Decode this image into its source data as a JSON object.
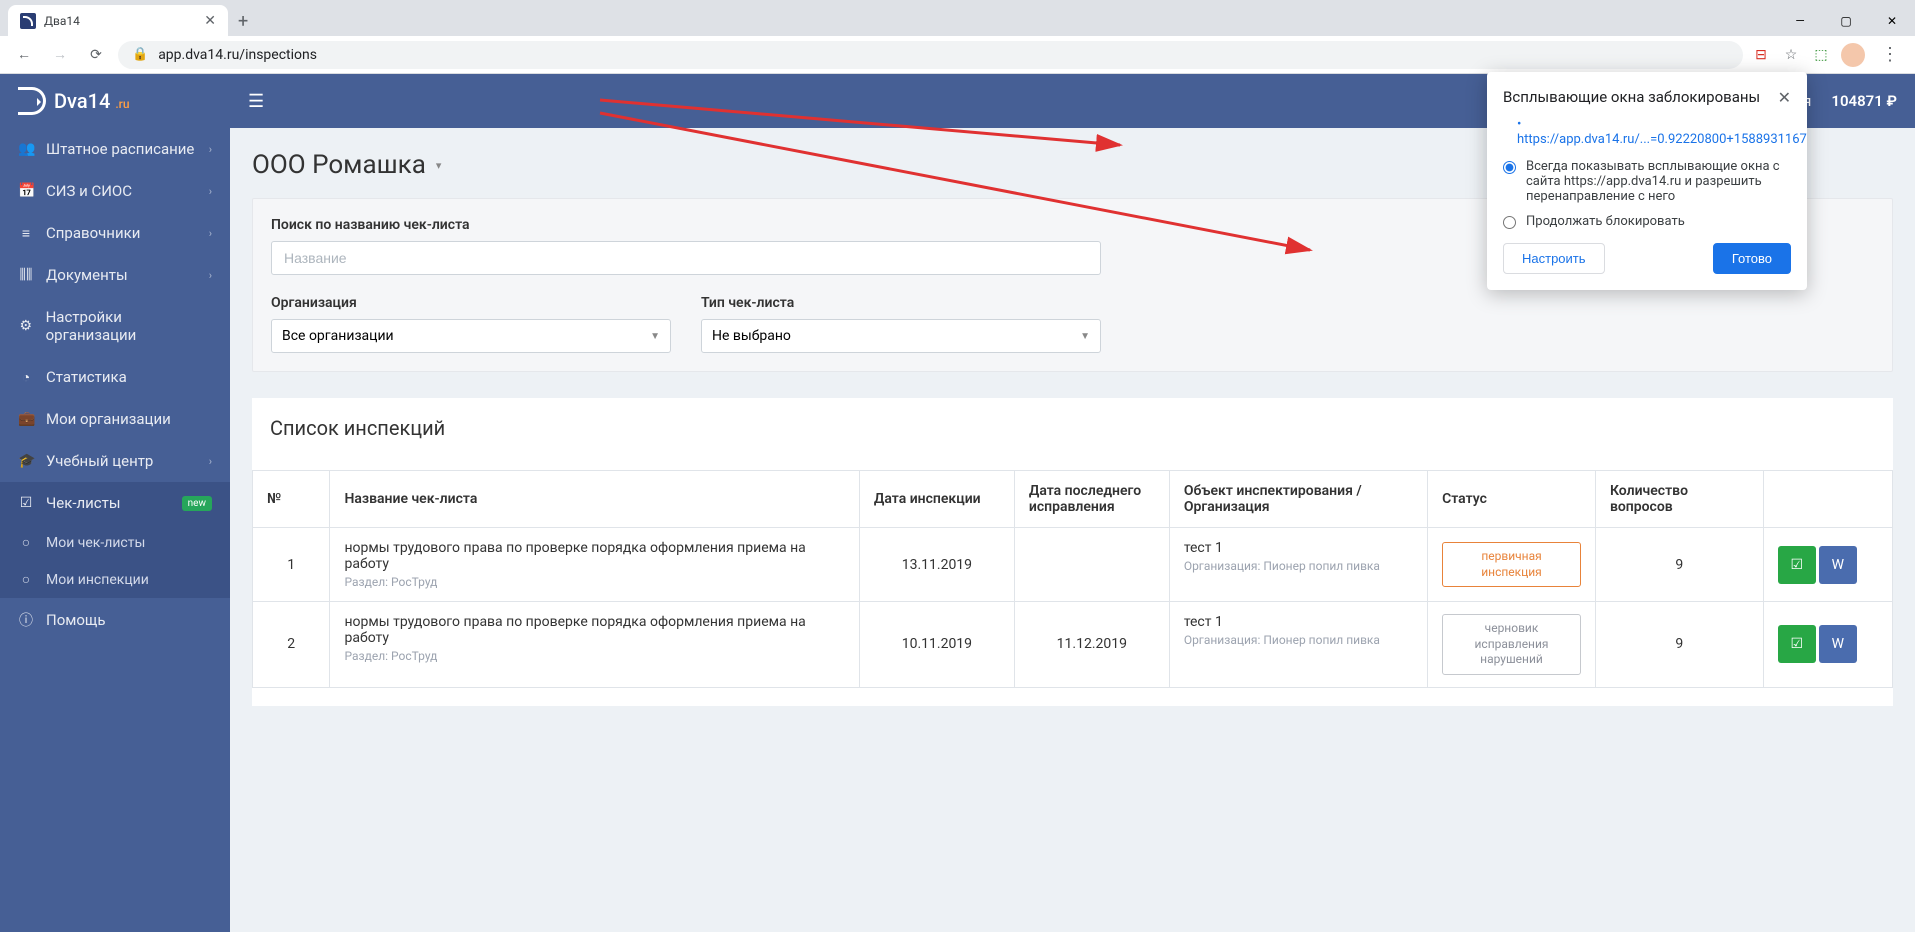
{
  "browser": {
    "tab_title": "Два14",
    "url_display": "app.dva14.ru/inspections"
  },
  "sidebar": {
    "logo": "Dva14",
    "logo_suffix": ".ru",
    "items": [
      {
        "icon": "users",
        "label": "Штатное расписание",
        "expandable": true
      },
      {
        "icon": "calendar",
        "label": "СИЗ и СИОС",
        "expandable": true
      },
      {
        "icon": "list",
        "label": "Справочники",
        "expandable": true
      },
      {
        "icon": "barcode",
        "label": "Документы",
        "expandable": true
      },
      {
        "icon": "gear",
        "label": "Настройки организации"
      },
      {
        "icon": "pie",
        "label": "Статистика"
      },
      {
        "icon": "briefcase",
        "label": "Мои организации"
      },
      {
        "icon": "grad",
        "label": "Учебный центр",
        "expandable": true
      },
      {
        "icon": "check",
        "label": "Чек-листы",
        "badge": "new",
        "active": true
      }
    ],
    "subitems": [
      {
        "icon": "circle",
        "label": "Мои чек-листы"
      },
      {
        "icon": "circle",
        "label": "Мои инспекции"
      }
    ],
    "help": {
      "icon": "info",
      "label": "Помощь"
    }
  },
  "topbar": {
    "right_label_partial": "ия",
    "balance": "104871 ₽"
  },
  "page": {
    "org_title": "ООО Ромашка",
    "filter": {
      "search_label": "Поиск по названию чек-листа",
      "search_placeholder": "Название",
      "org_label": "Организация",
      "org_value": "Все организации",
      "type_label": "Тип чек-листа",
      "type_value": "Не выбрано"
    },
    "list_title": "Список инспекций",
    "columns": {
      "num": "№",
      "name": "Название чек-листа",
      "date": "Дата инспекции",
      "fix_date": "Дата последнего исправления",
      "object": "Объект инспектирования / Организация",
      "status": "Статус",
      "qty": "Количество вопросов"
    },
    "rows": [
      {
        "num": "1",
        "name": "нормы трудового права по проверке порядка оформления приема на работу",
        "section": "Раздел: РосТруд",
        "date": "13.11.2019",
        "fix_date": "",
        "object": "тест 1",
        "org": "Организация: Пионер попил пивка",
        "status": "первичная инспекция",
        "status_class": "orange",
        "qty": "9"
      },
      {
        "num": "2",
        "name": "нормы трудового права по проверке порядка оформления приема на работу",
        "section": "Раздел: РосТруд",
        "date": "10.11.2019",
        "fix_date": "11.12.2019",
        "object": "тест 1",
        "org": "Организация: Пионер попил пивка",
        "status": "черновик исправления нарушений",
        "status_class": "gray",
        "qty": "9"
      }
    ]
  },
  "popup": {
    "title": "Всплывающие окна заблокированы",
    "link": "• https://app.dva14.ru/...=0.92220800+1588931167",
    "opt_allow": "Всегда показывать всплывающие окна с сайта https://app.dva14.ru и разрешить перенаправление с него",
    "opt_block": "Продолжать блокировать",
    "btn_settings": "Настроить",
    "btn_ok": "Готово"
  }
}
